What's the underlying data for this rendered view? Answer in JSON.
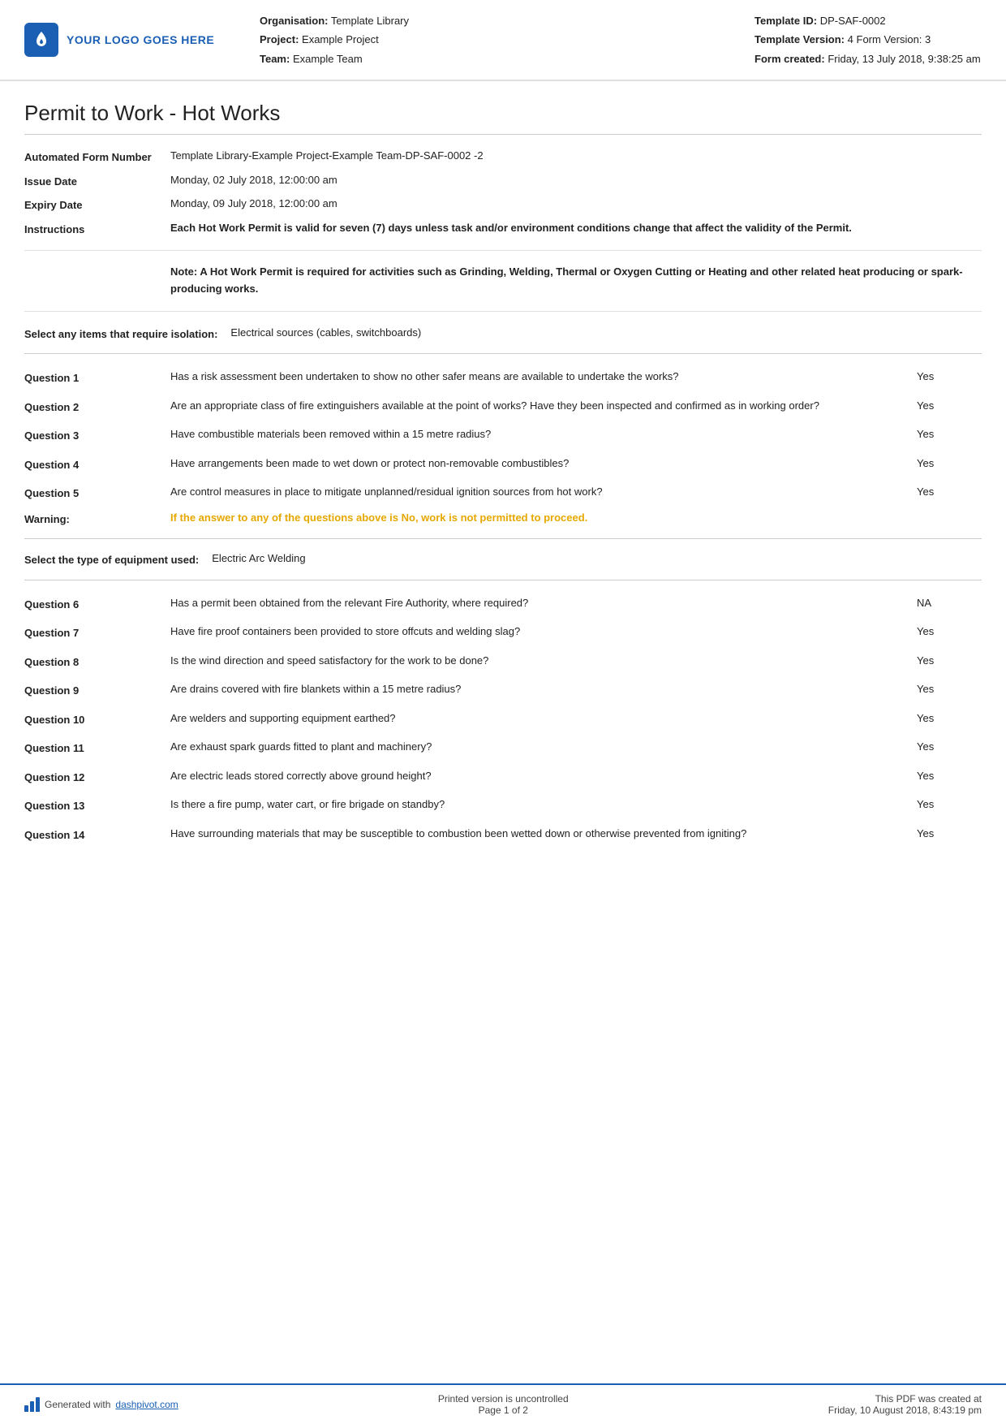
{
  "header": {
    "logo_text": "YOUR LOGO GOES HERE",
    "org_label": "Organisation:",
    "org_value": "Template Library",
    "project_label": "Project:",
    "project_value": "Example Project",
    "team_label": "Team:",
    "team_value": "Example Team",
    "template_id_label": "Template ID:",
    "template_id_value": "DP-SAF-0002",
    "template_version_label": "Template Version:",
    "template_version_value": "4",
    "form_version_label": "Form Version:",
    "form_version_value": "3",
    "form_created_label": "Form created:",
    "form_created_value": "Friday, 13 July 2018, 9:38:25 am"
  },
  "page_title": "Permit to Work - Hot Works",
  "fields": {
    "automated_label": "Automated Form Number",
    "automated_value": "Template Library-Example Project-Example Team-DP-SAF-0002  -2",
    "issue_date_label": "Issue Date",
    "issue_date_value": "Monday, 02 July 2018, 12:00:00 am",
    "expiry_date_label": "Expiry Date",
    "expiry_date_value": "Monday, 09 July 2018, 12:00:00 am",
    "instructions_label": "Instructions",
    "instructions_value": "Each Hot Work Permit is valid for seven (7) days unless task and/or environment conditions change that affect the validity of the Permit.",
    "note_text": "Note: A Hot Work Permit is required for activities such as Grinding, Welding, Thermal or Oxygen Cutting or Heating and other related heat producing or spark-producing works.",
    "isolation_label": "Select any items that require isolation:",
    "isolation_value": "Electrical sources (cables, switchboards)",
    "equipment_label": "Select the type of equipment used:",
    "equipment_value": "Electric Arc Welding"
  },
  "questions": [
    {
      "label": "Question 1",
      "text": "Has a risk assessment been undertaken to show no other safer means are available to undertake the works?",
      "answer": "Yes"
    },
    {
      "label": "Question 2",
      "text": "Are an appropriate class of fire extinguishers available at the point of works? Have they been inspected and confirmed as in working order?",
      "answer": "Yes"
    },
    {
      "label": "Question 3",
      "text": "Have combustible materials been removed within a 15 metre radius?",
      "answer": "Yes"
    },
    {
      "label": "Question 4",
      "text": "Have arrangements been made to wet down or protect non-removable combustibles?",
      "answer": "Yes"
    },
    {
      "label": "Question 5",
      "text": "Are control measures in place to mitigate unplanned/residual ignition sources from hot work?",
      "answer": "Yes"
    }
  ],
  "warning": {
    "label": "Warning:",
    "text": "If the answer to any of the questions above is No, work is not permitted to proceed."
  },
  "questions2": [
    {
      "label": "Question 6",
      "text": "Has a permit been obtained from the relevant Fire Authority, where required?",
      "answer": "NA"
    },
    {
      "label": "Question 7",
      "text": "Have fire proof containers been provided to store offcuts and welding slag?",
      "answer": "Yes"
    },
    {
      "label": "Question 8",
      "text": "Is the wind direction and speed satisfactory for the work to be done?",
      "answer": "Yes"
    },
    {
      "label": "Question 9",
      "text": "Are drains covered with fire blankets within a 15 metre radius?",
      "answer": "Yes"
    },
    {
      "label": "Question 10",
      "text": "Are welders and supporting equipment earthed?",
      "answer": "Yes"
    },
    {
      "label": "Question 11",
      "text": "Are exhaust spark guards fitted to plant and machinery?",
      "answer": "Yes"
    },
    {
      "label": "Question 12",
      "text": "Are electric leads stored correctly above ground height?",
      "answer": "Yes"
    },
    {
      "label": "Question 13",
      "text": "Is there a fire pump, water cart, or fire brigade on standby?",
      "answer": "Yes"
    },
    {
      "label": "Question 14",
      "text": "Have surrounding materials that may be susceptible to combustion been wetted down or otherwise prevented from igniting?",
      "answer": "Yes"
    }
  ],
  "footer": {
    "generated_text": "Generated with ",
    "dashpivot_link": "dashpivot.com",
    "center_line1": "Printed version is uncontrolled",
    "center_line2": "Page 1 of 2",
    "right_line1": "This PDF was created at",
    "right_line2": "Friday, 10 August 2018, 8:43:19 pm"
  }
}
